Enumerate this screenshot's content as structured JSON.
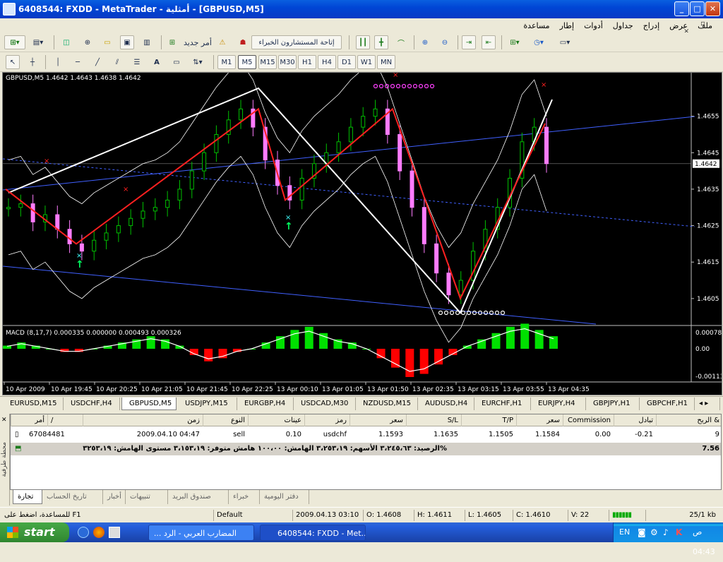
{
  "window": {
    "title": "6408544: FXDD - MetaTrader - أمثلية - [GBPUSD,M5]"
  },
  "menu": [
    "ملف",
    "عرض",
    "إدراج",
    "جداول",
    "أدوات",
    "إطار",
    "مساعدة"
  ],
  "toolbar": {
    "new_order": "أمر جديد",
    "expert_advisors": "إتاحة المستشارون الخبراء",
    "timeframes": [
      "M1",
      "M5",
      "M15",
      "M30",
      "H1",
      "H4",
      "D1",
      "W1",
      "MN"
    ],
    "active_timeframe": "M5"
  },
  "chart": {
    "header": "GBPUSD,M5  1.4642 1.4643 1.4638 1.4642",
    "price_ticks": [
      "1.4655",
      "1.4645",
      "1.4635",
      "1.4625",
      "1.4615",
      "1.4605"
    ],
    "current_price": "1.4642",
    "time_labels": [
      "10 Apr 2009",
      "10 Apr 19:45",
      "10 Apr 20:25",
      "10 Apr 21:05",
      "10 Apr 21:45",
      "10 Apr 22:25",
      "13 Apr 00:10",
      "13 Apr 01:05",
      "13 Apr 01:50",
      "13 Apr 02:35",
      "13 Apr 03:15",
      "13 Apr 03:55",
      "13 Apr 04:35"
    ],
    "macd_header": "MACD  (8,17,7)  0.000335  0.000000  0.000493  0.000326",
    "macd_ticks": [
      "0.000789",
      "0.00",
      "-0.00113"
    ],
    "colors": {
      "bull": "#00c000",
      "bear": "#ff7cff",
      "zigzag": "#ff2020",
      "pattern": "#ffffff",
      "channel": "#4060ff",
      "macd_pos": "#00e000",
      "macd_neg": "#ff0000"
    }
  },
  "chart_data": {
    "type": "candlestick",
    "symbol": "GBPUSD",
    "timeframe": "M5",
    "ylim": [
      1.4598,
      1.4665
    ],
    "series": [
      {
        "name": "close",
        "values": [
          1.463,
          1.4631,
          1.4626,
          1.4628,
          1.4624,
          1.462,
          1.4618,
          1.4621,
          1.4623,
          1.4625,
          1.4627,
          1.4629,
          1.463,
          1.4632,
          1.4635,
          1.464,
          1.4645,
          1.465,
          1.4654,
          1.4657,
          1.4652,
          1.4643,
          1.4636,
          1.4632,
          1.4638,
          1.4642,
          1.4645,
          1.4648,
          1.4652,
          1.4655,
          1.4657,
          1.465,
          1.464,
          1.463,
          1.462,
          1.4612,
          1.4606,
          1.461,
          1.4618,
          1.4624,
          1.463,
          1.4638,
          1.4648,
          1.4652,
          1.4642
        ]
      }
    ],
    "zigzag_points": [
      1.4635,
      1.462,
      1.4657,
      1.4632,
      1.4657,
      1.4605,
      1.4653
    ],
    "macd_values": [
      0.0001,
      0.0002,
      0.0001,
      0.0,
      -0.0001,
      -0.0001,
      0.0,
      0.0001,
      0.0002,
      0.0003,
      0.0004,
      0.0003,
      0.0001,
      -0.0002,
      -0.0004,
      -0.0003,
      -0.0001,
      0.0,
      0.0002,
      0.0004,
      0.0006,
      0.0007,
      0.0005,
      0.0003,
      0.0002,
      0.0,
      -0.0003,
      -0.0006,
      -0.0009,
      -0.0008,
      -0.0005,
      -0.0002,
      0.0001,
      0.0003,
      0.0005,
      0.0007,
      0.0008,
      0.0006,
      0.0004
    ]
  },
  "symbol_tabs": [
    "EURUSD,M15",
    "USDCHF,H4",
    "GBPUSD,M5",
    "USDJPY,M15",
    "EURGBP,H4",
    "USDCAD,M30",
    "NZDUSD,M15",
    "AUDUSD,H4",
    "EURCHF,H1",
    "EURJPY,H4",
    "GBPJPY,H1",
    "GBPCHF,H1"
  ],
  "active_symbol_tab": "GBPUSD,M5",
  "terminal": {
    "columns": [
      "أمر",
      "/",
      "زمن",
      "النوع",
      "عينات",
      "رمز",
      "سعر",
      "S/L",
      "T/P",
      "سعر",
      "Commission",
      "تبادل",
      "الربح &"
    ],
    "rows": [
      {
        "order": "67084481",
        "time": "2009.04.10 04:47",
        "type": "sell",
        "size": "0.10",
        "symbol": "usdchf",
        "price": "1.1593",
        "sl": "1.1635",
        "tp": "1.1505",
        "cur_price": "1.1584",
        "commission": "0.00",
        "swap": "-0.21",
        "profit": "9"
      }
    ],
    "balance_line": "%الرصيد: ٣،٢٤٥،٦٣  الأسهم: ٣،٢٥٣،١٩  الهامش: ١٠٠،٠٠  هامش متوفر: ٣،١٥٣،١٩  مستوى الهامش: ٣٢٥٣،١٩",
    "total_profit": "7.56",
    "tabs": [
      "تجارة",
      "تاريخ الحساب",
      "أخبار",
      "تنبيهات",
      "صندوق البريد",
      "خبراء",
      "دفتر اليومية"
    ],
    "side_label": "محطة طرفية"
  },
  "status": {
    "help": "للمساعدة، اضغط على F1",
    "profile": "Default",
    "datetime": "2009.04.13 03:10",
    "open": "O: 1.4608",
    "high": "H: 1.4611",
    "low": "L: 1.4605",
    "close": "C: 1.4610",
    "volume": "V: 22",
    "traffic": "25/1 kb"
  },
  "taskbar": {
    "start": "start",
    "tasks": [
      "المضارب العربي - الرد ...",
      "6408544: FXDD - Met..."
    ],
    "lang": "EN",
    "clock": "ص 04:43"
  }
}
